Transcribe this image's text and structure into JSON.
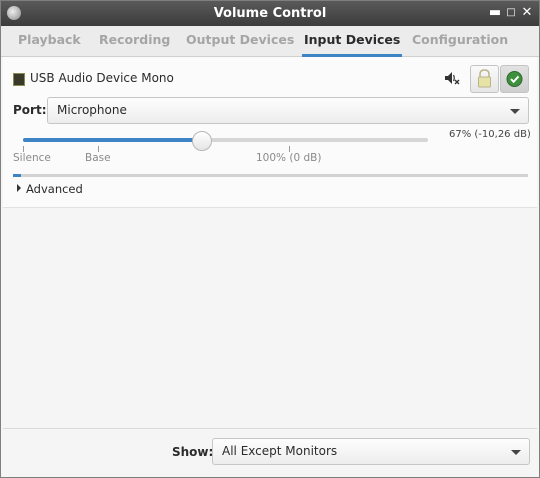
{
  "window": {
    "title": "Volume Control"
  },
  "tabs": [
    {
      "label": "Playback"
    },
    {
      "label": "Recording"
    },
    {
      "label": "Output Devices"
    },
    {
      "label": "Input Devices"
    },
    {
      "label": "Configuration"
    }
  ],
  "active_tab": "Input Devices",
  "device": {
    "name": "USB Audio Device Mono",
    "port_label": "Port:",
    "port_value": "Microphone",
    "volume_text": "67% (-10,26 dB)",
    "volume_fraction": 0.67,
    "scale_marks": [
      {
        "label": "Silence"
      },
      {
        "label": "Base"
      },
      {
        "label": "100% (0 dB)"
      }
    ],
    "peak_level": 0.015,
    "advanced_label": "Advanced",
    "icons": {
      "device": "audio-card-icon",
      "mute": "speaker-muted-icon",
      "lock": "lock-icon",
      "default": "set-default-check-icon"
    }
  },
  "footer": {
    "show_label": "Show:",
    "show_value": "All Except Monitors"
  },
  "colors": {
    "accent": "#3d84c6",
    "titlebar": "#4a4a4a"
  }
}
